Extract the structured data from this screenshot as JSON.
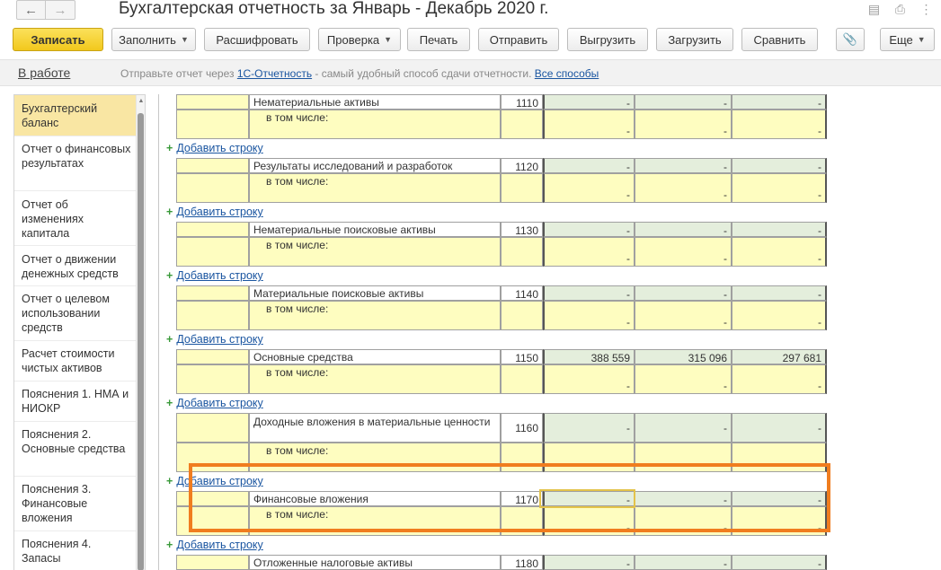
{
  "window": {
    "title": "Бухгалтерская отчетность за Январь - Декабрь 2020 г.",
    "back_icon": "arrow-left-icon",
    "forward_icon": "arrow-right-icon"
  },
  "toolbar": {
    "save": "Записать",
    "fill": "Заполнить",
    "decode": "Расшифровать",
    "check": "Проверка",
    "print": "Печать",
    "send": "Отправить",
    "export": "Выгрузить",
    "import": "Загрузить",
    "compare": "Сравнить",
    "more": "Еще"
  },
  "status": {
    "state": "В работе",
    "msg_prefix": "Отправьте отчет через ",
    "msg_link": "1С-Отчетность",
    "msg_middle": " - самый удобный способ сдачи отчетности. ",
    "msg_all": "Все способы"
  },
  "sidebar": {
    "items": [
      "Бухгалтерский баланс",
      "Отчет о финансовых результатах",
      "Отчет об изменениях капитала",
      "Отчет о движении денежных средств",
      "Отчет о целевом использовании средств",
      "Расчет стоимости чистых активов",
      "Пояснения 1. НМА и НИОКР",
      "Пояснения 2. Основные средства",
      "Пояснения 3. Финансовые вложения",
      "Пояснения 4. Запасы"
    ]
  },
  "report": {
    "add_row": "Добавить строку",
    "sub_label": "в том числе:",
    "rows": [
      {
        "name": "Нематериальные активы",
        "code": "1110",
        "v1": "-",
        "v2": "-",
        "v3": "-",
        "s1": "-",
        "s2": "-",
        "s3": "-"
      },
      {
        "name": "Результаты исследований и разработок",
        "code": "1120",
        "v1": "-",
        "v2": "-",
        "v3": "-",
        "s1": "-",
        "s2": "-",
        "s3": "-"
      },
      {
        "name": "Нематериальные поисковые активы",
        "code": "1130",
        "v1": "-",
        "v2": "-",
        "v3": "-",
        "s1": "-",
        "s2": "-",
        "s3": "-"
      },
      {
        "name": "Материальные поисковые активы",
        "code": "1140",
        "v1": "-",
        "v2": "-",
        "v3": "-",
        "s1": "-",
        "s2": "-",
        "s3": "-"
      },
      {
        "name": "Основные средства",
        "code": "1150",
        "v1": "388 559",
        "v2": "315 096",
        "v3": "297 681",
        "s1": "-",
        "s2": "-",
        "s3": "-"
      },
      {
        "name": "Доходные вложения в материальные ценности",
        "code": "1160",
        "v1": "-",
        "v2": "-",
        "v3": "-",
        "s1": "-",
        "s2": "-",
        "s3": "-"
      },
      {
        "name": "Финансовые вложения",
        "code": "1170",
        "v1": "-",
        "v2": "-",
        "v3": "-",
        "s1": "-",
        "s2": "-",
        "s3": "-"
      },
      {
        "name": "Отложенные налоговые активы",
        "code": "1180",
        "v1": "-",
        "v2": "-",
        "v3": "-"
      }
    ]
  },
  "colors": {
    "accent": "#f2c81d",
    "highlight": "#f07d1f",
    "input_yellow": "#fefdc0",
    "value_green": "#e4eedc",
    "link": "#1a55a0"
  }
}
